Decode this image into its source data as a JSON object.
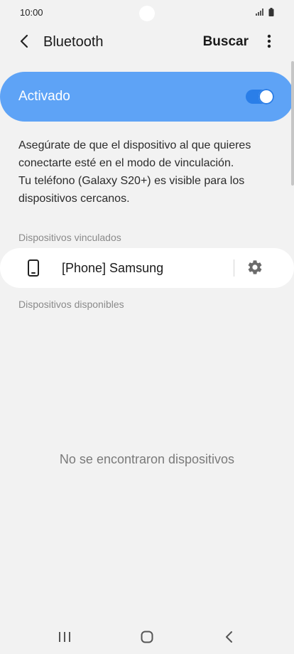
{
  "status_bar": {
    "time": "10:00",
    "icons": [
      "signal-icon",
      "battery-icon"
    ]
  },
  "app_bar": {
    "title": "Bluetooth",
    "search_label": "Buscar",
    "icons": [
      "back-icon",
      "more-vert-icon"
    ]
  },
  "master_switch": {
    "label": "Activado",
    "on": true,
    "accent_color": "#5ea3f6"
  },
  "description": {
    "line1": "Asegúrate de que el dispositivo al que quieres conectarte esté en el modo de vinculación.",
    "line2": "Tu teléfono (Galaxy S20+) es visible para los dispositivos cercanos."
  },
  "paired": {
    "header": "Dispositivos vinculados",
    "devices": [
      {
        "name": "[Phone] Samsung",
        "icon": "phone-icon",
        "settings_icon": "gear-icon"
      }
    ]
  },
  "available": {
    "header": "Dispositivos disponibles",
    "empty_message": "No se encontraron dispositivos"
  },
  "nav_bar": {
    "icons": [
      "recents-icon",
      "home-icon",
      "nav-back-icon"
    ]
  }
}
